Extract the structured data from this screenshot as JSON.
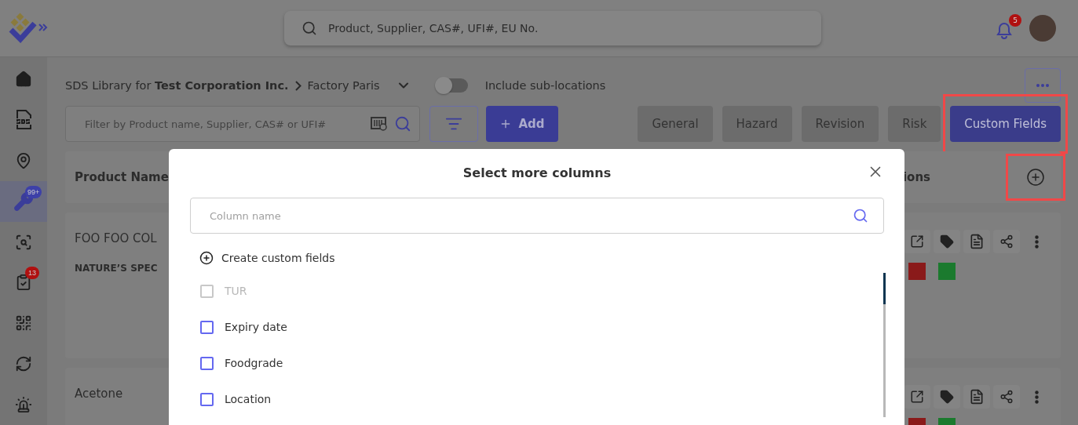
{
  "header": {
    "search_placeholder": "Product, Supplier, CAS#, UFI#, EU No.",
    "notification_count": "5"
  },
  "sidebar": {
    "items": [
      {
        "kind": "home",
        "selected": false
      },
      {
        "kind": "sds",
        "selected": false
      },
      {
        "kind": "pin",
        "selected": false
      },
      {
        "kind": "wrench",
        "selected": true,
        "badge": {
          "count": "99+",
          "color": "#3d40a8"
        }
      },
      {
        "kind": "globe-search",
        "selected": false
      },
      {
        "kind": "clipboard",
        "selected": false,
        "badge": {
          "count": "13",
          "color": "#b01010"
        }
      },
      {
        "kind": "qr",
        "selected": false
      },
      {
        "kind": "sync",
        "selected": false
      },
      {
        "kind": "alarm",
        "selected": false
      }
    ]
  },
  "breadcrumb": {
    "prefix": "SDS Library for",
    "company": "Test Corporation Inc.",
    "location": "Factory Paris"
  },
  "sub_locations": {
    "label": "Include sub-locations",
    "on": false
  },
  "filter": {
    "placeholder": "Filter by Product name, Supplier, CAS# or UFI#"
  },
  "add_button": {
    "label": "Add"
  },
  "column_groups": [
    {
      "label": "General",
      "selected": false,
      "highlighted": false
    },
    {
      "label": "Hazard",
      "selected": false,
      "highlighted": false
    },
    {
      "label": "Revision",
      "selected": false,
      "highlighted": false
    },
    {
      "label": "Risk",
      "selected": false,
      "highlighted": false
    },
    {
      "label": "Custom Fields",
      "selected": true,
      "highlighted": true
    }
  ],
  "table": {
    "columns": [
      "Product Name",
      "ions"
    ],
    "add_column_highlighted": true,
    "rows": [
      {
        "name": "FOO FOO COL",
        "supplier": "NATURE’S SPEC"
      },
      {
        "name": "Acetone"
      }
    ]
  },
  "modal": {
    "title": "Select more columns",
    "search_placeholder": "Column name",
    "create_label": "Create custom fields",
    "options": [
      {
        "label": "TUR",
        "checked": false,
        "disabled": true
      },
      {
        "label": "Expiry date",
        "checked": false,
        "disabled": false
      },
      {
        "label": "Foodgrade",
        "checked": false,
        "disabled": false
      },
      {
        "label": "Location",
        "checked": false,
        "disabled": false
      }
    ]
  }
}
